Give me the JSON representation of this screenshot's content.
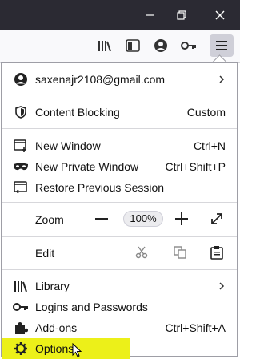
{
  "window": {
    "minimize_icon": "minimize-icon",
    "restore_icon": "restore-icon",
    "close_icon": "close-icon",
    "titlebar_color": "#2b2a33"
  },
  "toolbar": {
    "icons": [
      "library-icon",
      "sidebar-icon",
      "account-icon",
      "key-icon",
      "hamburger-menu-icon"
    ]
  },
  "menu": {
    "account_email": "saxenajr2108@gmail.com",
    "content_blocking_label": "Content Blocking",
    "content_blocking_value": "Custom",
    "new_window_label": "New Window",
    "new_window_shortcut": "Ctrl+N",
    "new_private_label": "New Private Window",
    "new_private_shortcut": "Ctrl+Shift+P",
    "restore_session_label": "Restore Previous Session",
    "zoom_label": "Zoom",
    "zoom_minus": "—",
    "zoom_value": "100%",
    "zoom_plus": "+",
    "edit_label": "Edit",
    "library_label": "Library",
    "logins_label": "Logins and Passwords",
    "addons_label": "Add-ons",
    "addons_shortcut": "Ctrl+Shift+A",
    "options_label": "Options",
    "highlight_color": "#ecf019"
  }
}
